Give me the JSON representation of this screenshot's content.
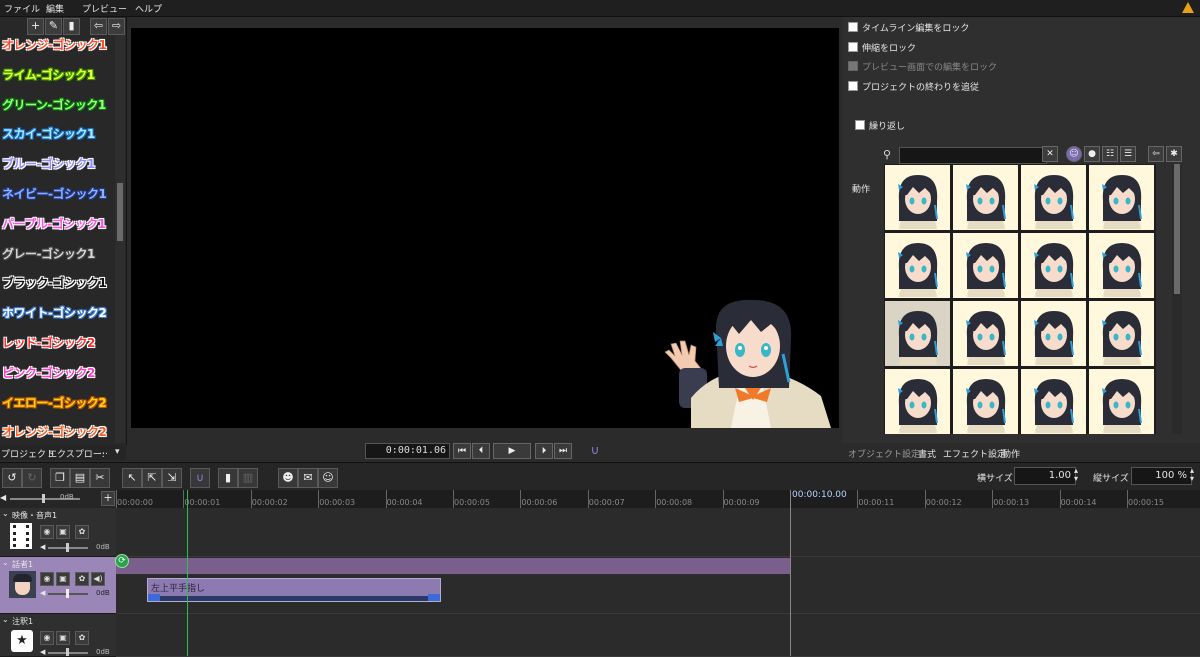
{
  "menu": [
    "ファイル",
    "編集",
    "プレビュー",
    "ヘルプ"
  ],
  "left_panel": {
    "toolbar_icons": [
      "plus-icon",
      "edit-icon",
      "trash-icon",
      "import-icon",
      "export-icon"
    ],
    "presets": [
      {
        "label": "オレンジ-ゴシック1",
        "color": "#ff4d2e",
        "stroke": "#ffffff"
      },
      {
        "label": "ライム-ゴシック1",
        "color": "#f4ff3a",
        "stroke": "#3aa000"
      },
      {
        "label": "グリーン-ゴシック1",
        "color": "#9cff72",
        "stroke": "#0a7a16"
      },
      {
        "label": "スカイ-ゴシック1",
        "color": "#a9ecff",
        "stroke": "#1a73d0"
      },
      {
        "label": "ブルー-ゴシック1",
        "color": "#8d8bff",
        "stroke": "#ffffff"
      },
      {
        "label": "ネイビー-ゴシック1",
        "color": "#8eb0ff",
        "stroke": "#223a8a"
      },
      {
        "label": "パープル-ゴシック1",
        "color": "#ff4fe6",
        "stroke": "#ffffff"
      },
      {
        "label": "グレー-ゴシック1",
        "color": "#d6d6d6",
        "stroke": "#444444"
      },
      {
        "label": "ブラック-ゴシック1",
        "color": "#111111",
        "stroke": "#ffffff"
      },
      {
        "label": "ホワイト-ゴシック2",
        "color": "#ffffff",
        "stroke": "#3e7fd6"
      },
      {
        "label": "レッド-ゴシック2",
        "color": "#ff2a2a",
        "stroke": "#ffffff"
      },
      {
        "label": "ピンク-ゴシック2",
        "color": "#ff3bc7",
        "stroke": "#ffffff"
      },
      {
        "label": "イエロー-ゴシック2",
        "color": "#ffd21a",
        "stroke": "#c05a00"
      },
      {
        "label": "オレンジ-ゴシック2",
        "color": "#ff5a1e",
        "stroke": "#ffffff"
      }
    ],
    "bottom_tabs": [
      "プロジェクト",
      "エクスプロー:",
      "…",
      "▾"
    ]
  },
  "preview": {
    "time": "0:00:01.06"
  },
  "right_panel": {
    "checkboxes": [
      {
        "label": "タイムライン編集をロック",
        "disabled": false
      },
      {
        "label": "伸縮をロック",
        "disabled": false
      },
      {
        "label": "プレビュー画面での編集をロック",
        "disabled": true
      },
      {
        "label": "プロジェクトの終わりを追従",
        "disabled": false
      }
    ],
    "repeat_label": "繰り返し",
    "motion_label": "動作",
    "search_placeholder": "",
    "tabs": [
      "オブジェクト設定",
      "書式",
      "エフェクト設定",
      "動作"
    ]
  },
  "timeline": {
    "horizontal_size_label": "横サイズ",
    "horizontal_size": "1.00",
    "vertical_size_label": "縦サイズ",
    "vertical_size": "100 %",
    "master_volume": "0dB",
    "current_time": "00:00:10.00",
    "ruler": [
      "00:00:00",
      "00:00:01",
      "00:00:02",
      "00:00:03",
      "00:00:04",
      "00:00:05",
      "00:00:06",
      "00:00:07",
      "00:00:08",
      "00:00:09",
      "00:00:10",
      "00:00:11",
      "00:00:12",
      "00:00:13",
      "00:00:14",
      "00:00:15"
    ],
    "tracks": [
      {
        "name": "映像・音声1",
        "volume": "0dB"
      },
      {
        "name": "話者1",
        "volume": "0dB"
      },
      {
        "name": "注釈1",
        "volume": "0dB"
      }
    ],
    "clip_label": "左上平手指し",
    "end_marker_glyph": "⟳"
  },
  "colors": {
    "accent_timeline": "#7a5f8c",
    "clip": "#8d7ab0",
    "playhead": "#27c24c",
    "warning": "#e8a01a"
  }
}
